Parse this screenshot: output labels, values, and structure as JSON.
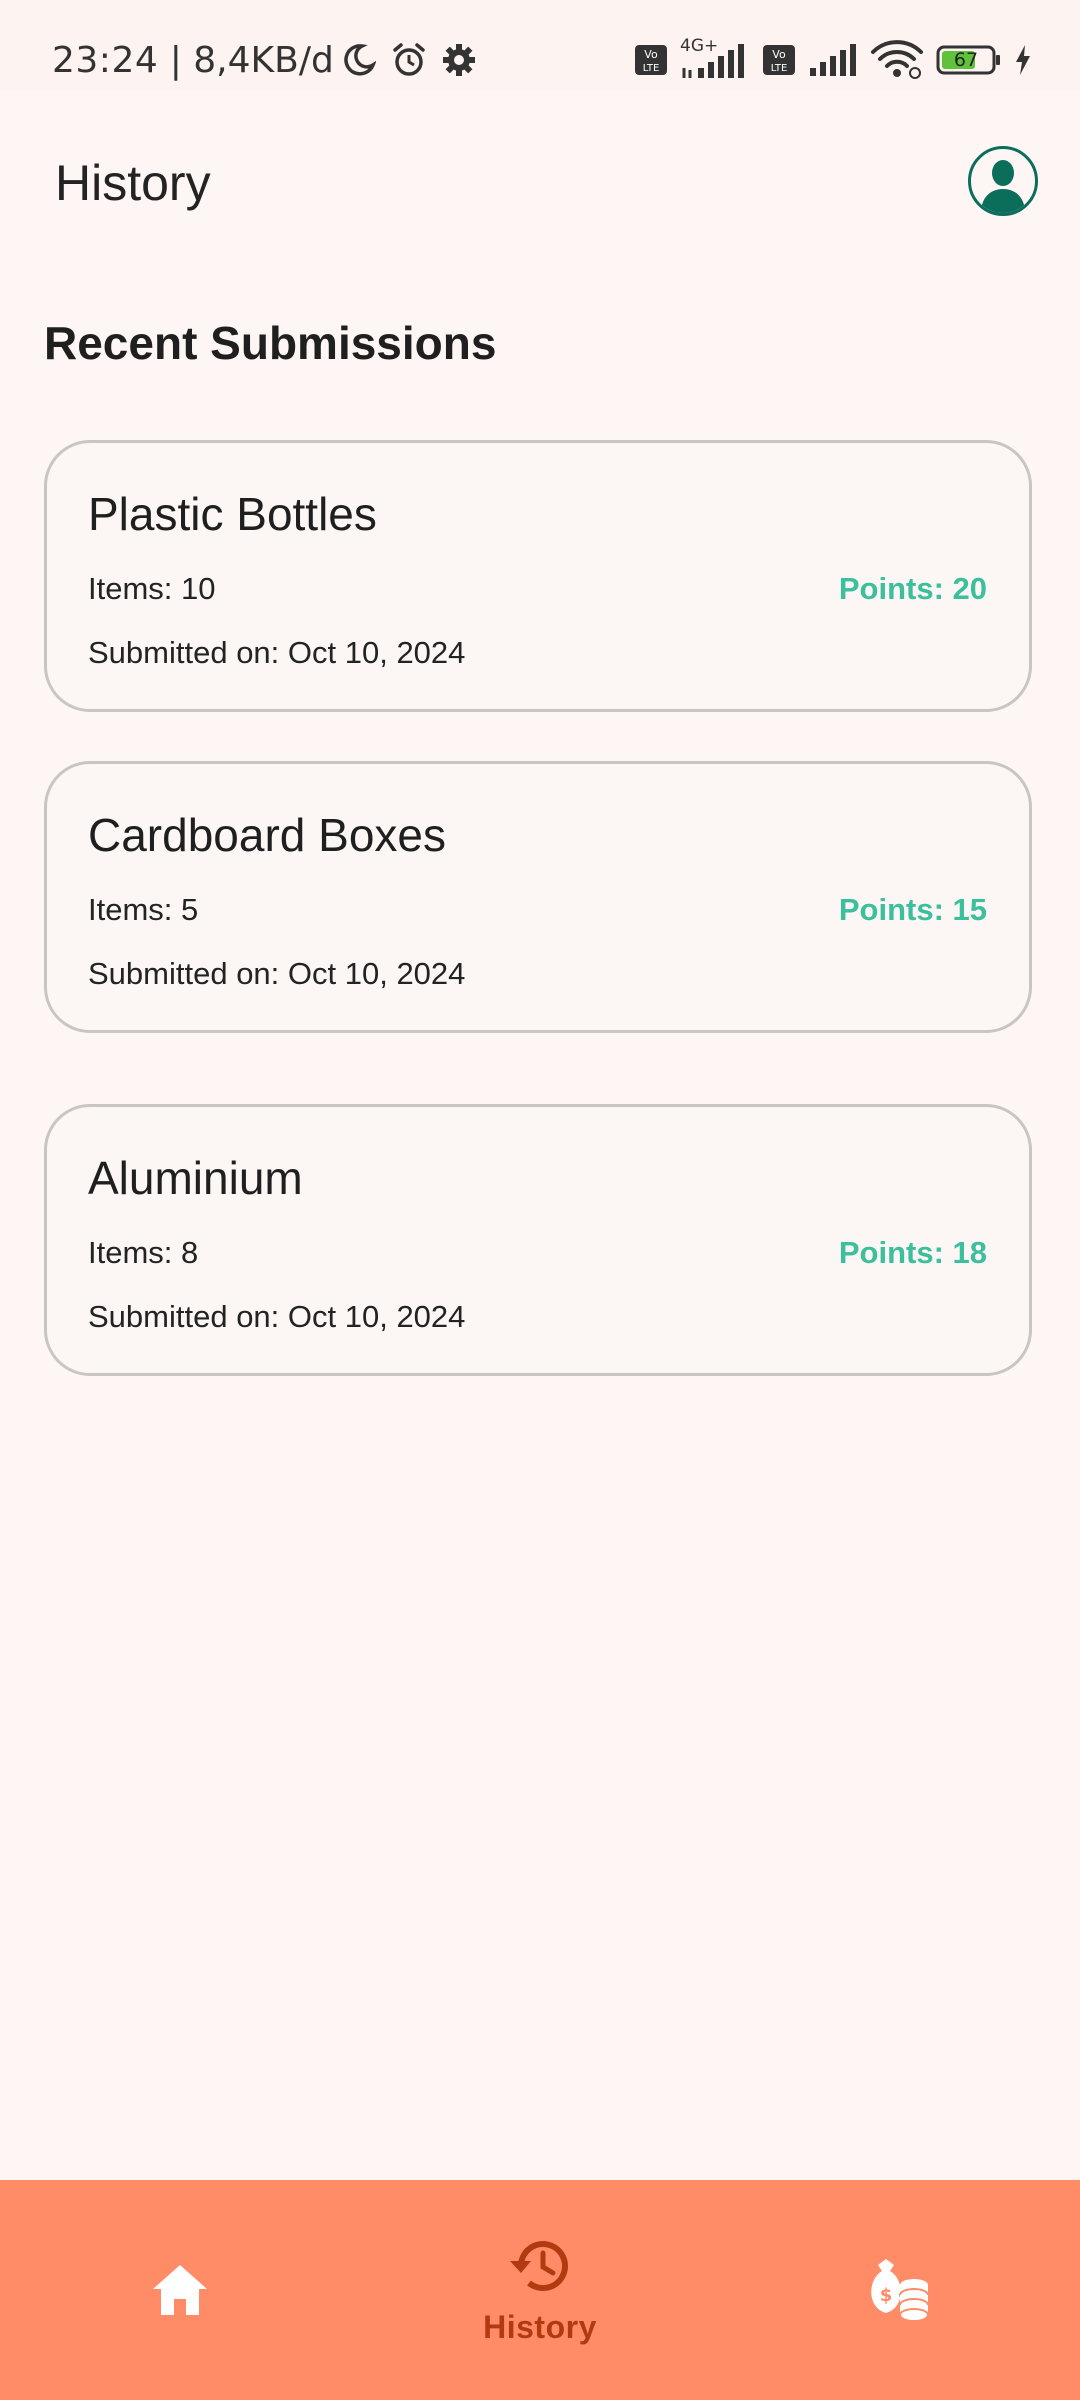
{
  "status_bar": {
    "time": "23:24",
    "network_speed": "8,4KB/d",
    "battery_level": "67",
    "network_label": "4G+",
    "icons": [
      "moon-icon",
      "alarm-icon",
      "settings-gear-icon",
      "volte-icon",
      "signal-icon",
      "wifi-icon",
      "battery-icon",
      "charging-icon"
    ]
  },
  "header": {
    "title": "History",
    "avatar_icon": "account-avatar-icon"
  },
  "section": {
    "title": "Recent Submissions"
  },
  "submissions": [
    {
      "title": "Plastic Bottles",
      "items": "Items: 10",
      "points": "Points: 20",
      "date": "Submitted on: Oct 10, 2024"
    },
    {
      "title": "Cardboard Boxes",
      "items": "Items: 5",
      "points": "Points: 15",
      "date": "Submitted on: Oct 10, 2024"
    },
    {
      "title": "Aluminium",
      "items": "Items: 8",
      "points": "Points: 18",
      "date": "Submitted on: Oct 10, 2024"
    }
  ],
  "bottom_nav": {
    "items": [
      {
        "icon": "home-icon",
        "label": "",
        "active": false
      },
      {
        "icon": "history-icon",
        "label": "History",
        "active": true
      },
      {
        "icon": "rewards-money-icon",
        "label": "",
        "active": false
      }
    ]
  },
  "colors": {
    "background": "#fef6f4",
    "accent_points": "#3cbf9c",
    "nav_background": "#ff8c66",
    "nav_active": "#b23a10",
    "avatar": "#0b6e5b"
  }
}
